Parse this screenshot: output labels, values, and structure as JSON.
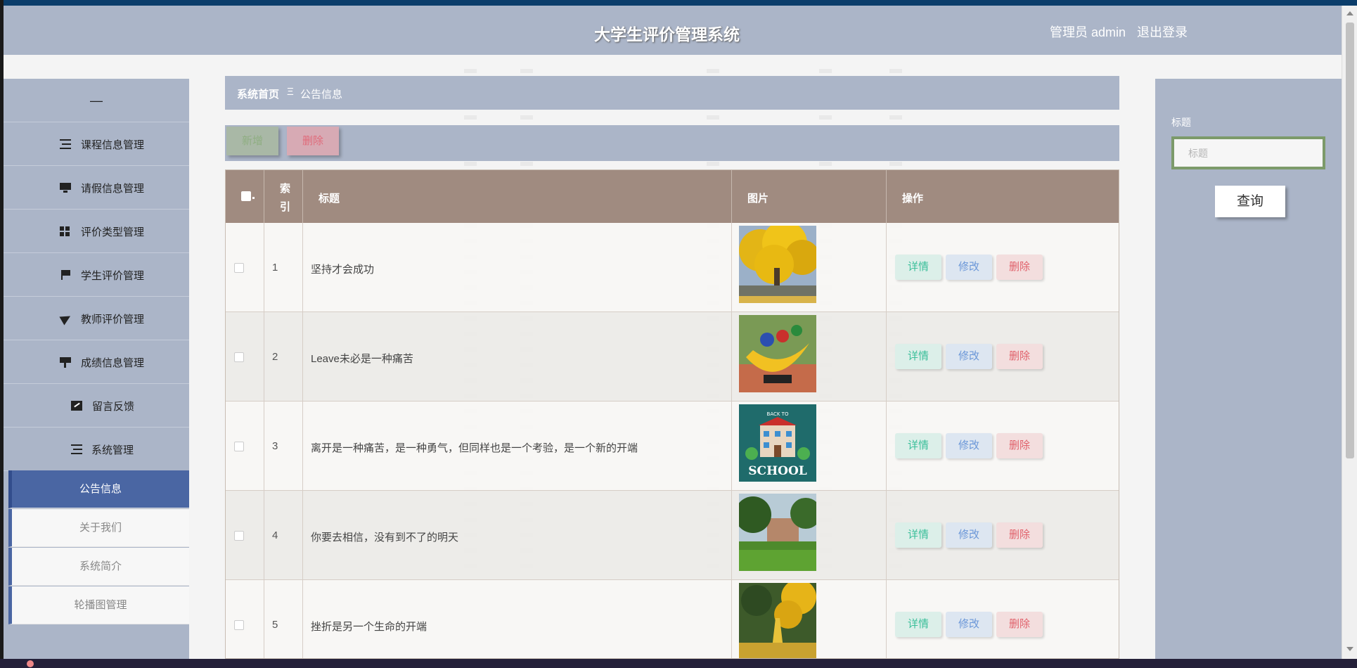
{
  "header": {
    "title": "大学生评价管理系统",
    "user": "管理员 admin",
    "logout": "退出登录"
  },
  "sidebar": {
    "collapse": "—",
    "items": [
      {
        "label": "课程信息管理",
        "icon": "list-icon"
      },
      {
        "label": "请假信息管理",
        "icon": "monitor-icon"
      },
      {
        "label": "评价类型管理",
        "icon": "grid-icon"
      },
      {
        "label": "学生评价管理",
        "icon": "flag-icon"
      },
      {
        "label": "教师评价管理",
        "icon": "paper-plane-icon"
      },
      {
        "label": "成绩信息管理",
        "icon": "paint-roller-icon"
      },
      {
        "label": "留言反馈",
        "icon": "chart-icon"
      },
      {
        "label": "系统管理",
        "icon": "list-icon"
      }
    ],
    "subitems": [
      {
        "label": "公告信息",
        "active": true
      },
      {
        "label": "关于我们",
        "active": false
      },
      {
        "label": "系统简介",
        "active": false
      },
      {
        "label": "轮播图管理",
        "active": false
      }
    ]
  },
  "breadcrumb": {
    "home": "系统首页",
    "separator": "Ξ",
    "current": "公告信息"
  },
  "toolbar": {
    "add": "新增",
    "delete": "删除"
  },
  "table": {
    "headers": {
      "index": "索引",
      "title": "标题",
      "image": "图片",
      "actions": "操作"
    },
    "rows": [
      {
        "index": "1",
        "title": "坚持才会成功",
        "image": "yellow ginkgo tree in campus"
      },
      {
        "index": "2",
        "title": "Leave未必是一种痛苦",
        "image": "colorful campus sculpture"
      },
      {
        "index": "3",
        "title": "离开是一种痛苦，是一种勇气，但同样也是一个考验，是一个新的开端",
        "image": "back to school illustration"
      },
      {
        "index": "4",
        "title": "你要去相信，没有到不了的明天",
        "image": "campus lawn and building"
      },
      {
        "index": "5",
        "title": "挫折是另一个生命的开端",
        "image": "ginkgo avenue path"
      }
    ],
    "actions": {
      "detail": "详情",
      "edit": "修改",
      "delete": "删除"
    }
  },
  "image_text": {
    "school_banner": "BACK TO",
    "school_word": "SCHOOL"
  },
  "search": {
    "label": "标题",
    "placeholder": "标题",
    "button": "查询"
  }
}
